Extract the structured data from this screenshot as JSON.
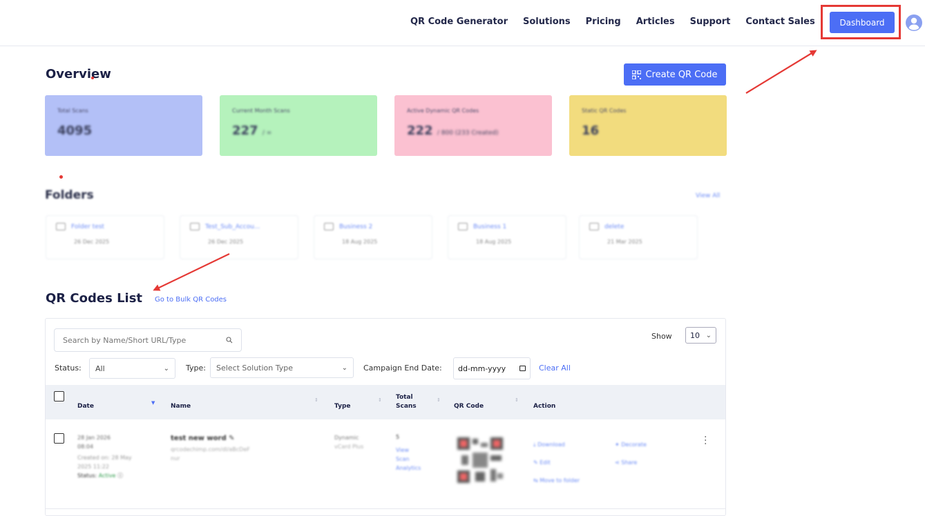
{
  "nav": {
    "links": [
      "QR Code Generator",
      "Solutions",
      "Pricing",
      "Articles",
      "Support",
      "Contact Sales"
    ],
    "dashboard_label": "Dashboard"
  },
  "overview": {
    "title": "Overview",
    "create_button": "Create QR Code",
    "stats": [
      {
        "label": "Total Scans",
        "value": "4095",
        "suffix": "",
        "color": "#b3c0f7"
      },
      {
        "label": "Current Month Scans",
        "value": "227",
        "suffix": "/ ∞",
        "color": "#b5f2bc"
      },
      {
        "label": "Active Dynamic QR Codes",
        "value": "222",
        "suffix": "/ 800 (233 Created)",
        "color": "#fbc1d1"
      },
      {
        "label": "Static QR Codes",
        "value": "16",
        "suffix": "",
        "color": "#f2dc7e"
      }
    ]
  },
  "folders": {
    "title": "Folders",
    "view_all": "View All",
    "items": [
      {
        "name": "Folder test",
        "date": "26 Dec 2025"
      },
      {
        "name": "Test_Sub_Accou...",
        "date": "26 Dec 2025"
      },
      {
        "name": "Business 2",
        "date": "18 Aug 2025"
      },
      {
        "name": "Business 1",
        "date": "18 Aug 2025"
      },
      {
        "name": "delete",
        "date": "21 Mar 2025"
      }
    ]
  },
  "list": {
    "title": "QR Codes List",
    "bulk_link": "Go to Bulk QR Codes",
    "search_placeholder": "Search by Name/Short URL/Type",
    "show_label": "Show",
    "show_value": "10",
    "status_label": "Status:",
    "status_value": "All",
    "type_label": "Type:",
    "type_placeholder": "Select Solution Type",
    "campaign_label": "Campaign End Date:",
    "date_placeholder": "dd-mm-yyyy",
    "clear_all": "Clear All",
    "columns": {
      "date": "Date",
      "name": "Name",
      "type": "Type",
      "scans_1": "Total",
      "scans_2": "Scans",
      "qr": "QR Code",
      "action": "Action"
    },
    "rows": [
      {
        "date_1": "28 Jan 2026",
        "date_2": "08:04",
        "created_1": "Created on: 28 May",
        "created_2": "2025 11:22",
        "status_label": "Status:",
        "status_value": "Active",
        "name": "test new word",
        "url_1": "qrcodechimp.com/dl/aBcDeF",
        "url_2": "nur",
        "type_1": "Dynamic",
        "type_2": "vCard Plus",
        "scans": "5",
        "view_1": "View",
        "view_2": "Scan",
        "view_3": "Analytics",
        "actions": [
          "Download",
          "Edit",
          "Move to folder",
          "Decorate",
          "Share"
        ]
      }
    ]
  }
}
